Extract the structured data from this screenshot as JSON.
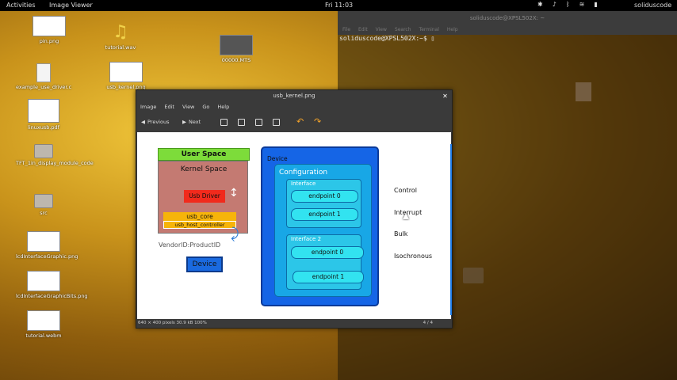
{
  "topbar": {
    "activities": "Activities",
    "app_name": "Image Viewer",
    "clock": "Fri 11:03",
    "user": "soliduscode",
    "tray_icons": [
      "bluetooth-icon",
      "volume-icon",
      "bluetooth-icon",
      "wifi-icon",
      "battery-icon",
      "power-icon"
    ]
  },
  "desktop": {
    "icons": [
      {
        "label": "pin.png",
        "type": "image"
      },
      {
        "label": "tutorial.wav",
        "type": "audio"
      },
      {
        "label": "00000.MTS",
        "type": "video"
      },
      {
        "label": "example_use_driver.c",
        "type": "doc"
      },
      {
        "label": "usb_kernel.png",
        "type": "image"
      },
      {
        "label": "linuxusb.pdf",
        "type": "doc"
      },
      {
        "label": "TFT_1in_display_module_code",
        "type": "folder"
      },
      {
        "label": "src",
        "type": "folder"
      },
      {
        "label": "lcdInterfaceGraphic.png",
        "type": "image"
      },
      {
        "label": "lcdInterfaceGraphicBits.png",
        "type": "image"
      },
      {
        "label": "tutorial.webm",
        "type": "video"
      }
    ]
  },
  "terminal": {
    "title": "soliduscode@XPSL502X: ~",
    "menu": [
      "File",
      "Edit",
      "View",
      "Search",
      "Terminal",
      "Help"
    ],
    "prompt": "soliduscode@XPSL502X:~$ "
  },
  "viewer": {
    "title": "usb_kernel.png",
    "menu": [
      "Image",
      "Edit",
      "View",
      "Go",
      "Help"
    ],
    "toolbar": {
      "previous": "Previous",
      "next": "Next"
    },
    "status": "640 × 400 pixels  30.9 kB  100%",
    "page_counter": "4 / 4"
  },
  "diagram": {
    "user_space": "User Space",
    "kernel_space": "Kernel Space",
    "usb_driver": "Usb Driver",
    "usb_core": "usb_core",
    "usb_host_controller": "usb_host_controller",
    "vendor_product": "VendorID:ProductID",
    "device_box": "Device",
    "device_panel_label": "Device",
    "configuration": "Configuration",
    "interface_1": "Interface",
    "interface_2": "Interface  2",
    "endpoints": [
      "endpoint 0",
      "endpoint 1",
      "endpoint 0",
      "endpoint 1"
    ],
    "transfer_types": [
      "Control",
      "Interrupt",
      "Bulk",
      "Isochronous"
    ]
  }
}
